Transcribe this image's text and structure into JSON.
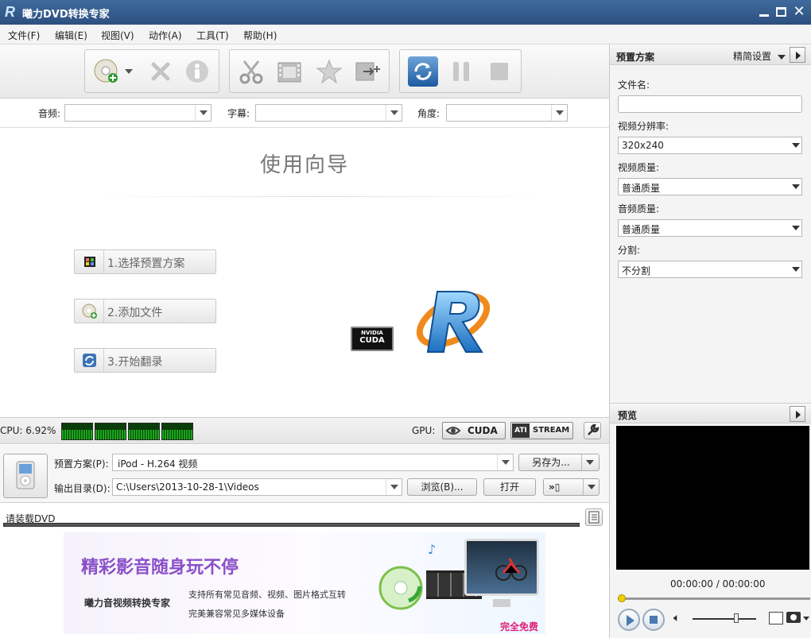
{
  "window": {
    "title": "曦力DVD转换专家"
  },
  "menu": [
    "文件(F)",
    "编辑(E)",
    "视图(V)",
    "动作(A)",
    "工具(T)",
    "帮助(H)"
  ],
  "selectors": {
    "audio_label": "音频:",
    "subtitle_label": "字幕:",
    "angle_label": "角度:"
  },
  "wizard": {
    "title": "使用向导",
    "steps": [
      "1.选择预置方案",
      "2.添加文件",
      "3.开始翻录"
    ],
    "cuda_brand": "NVIDIA",
    "cuda_text": "CUDA"
  },
  "status": {
    "cpu": "CPU: 6.92%",
    "gpu_label": "GPU:",
    "cuda_badge": "CUDA",
    "stream_badge_ati": "ATI",
    "stream_badge": "STREAM"
  },
  "output": {
    "preset_label": "预置方案(P):",
    "preset_value": "iPod - H.264 视频",
    "save_as": "另存为...",
    "dir_label": "输出目录(D):",
    "dir_value": "C:\\Users\\2013-10-28-1\\Videos",
    "browse": "浏览(B)...",
    "open": "打开"
  },
  "load_status": "请装载DVD",
  "banner": {
    "headline": "精彩影音随身玩不停",
    "product": "曦力音视频转换专家",
    "line1": "支持所有常见音频、视频、图片格式互转",
    "line2": "完美兼容常见多媒体设备",
    "free": "完全免费"
  },
  "right_panel": {
    "header": "预置方案",
    "mode": "精简设置",
    "filename_label": "文件名:",
    "filename_value": "",
    "resolution_label": "视频分辨率:",
    "resolution_value": "320x240",
    "vquality_label": "视频质量:",
    "vquality_value": "普通质量",
    "aquality_label": "音频质量:",
    "aquality_value": "普通质量",
    "split_label": "分割:",
    "split_value": "不分割",
    "preview_header": "预览",
    "time": "00:00:00 / 00:00:00",
    "volume": 0.7,
    "progress": 0
  },
  "colors": {
    "titlebar": "#2f5586",
    "meter_green": "#1aaa1a"
  }
}
